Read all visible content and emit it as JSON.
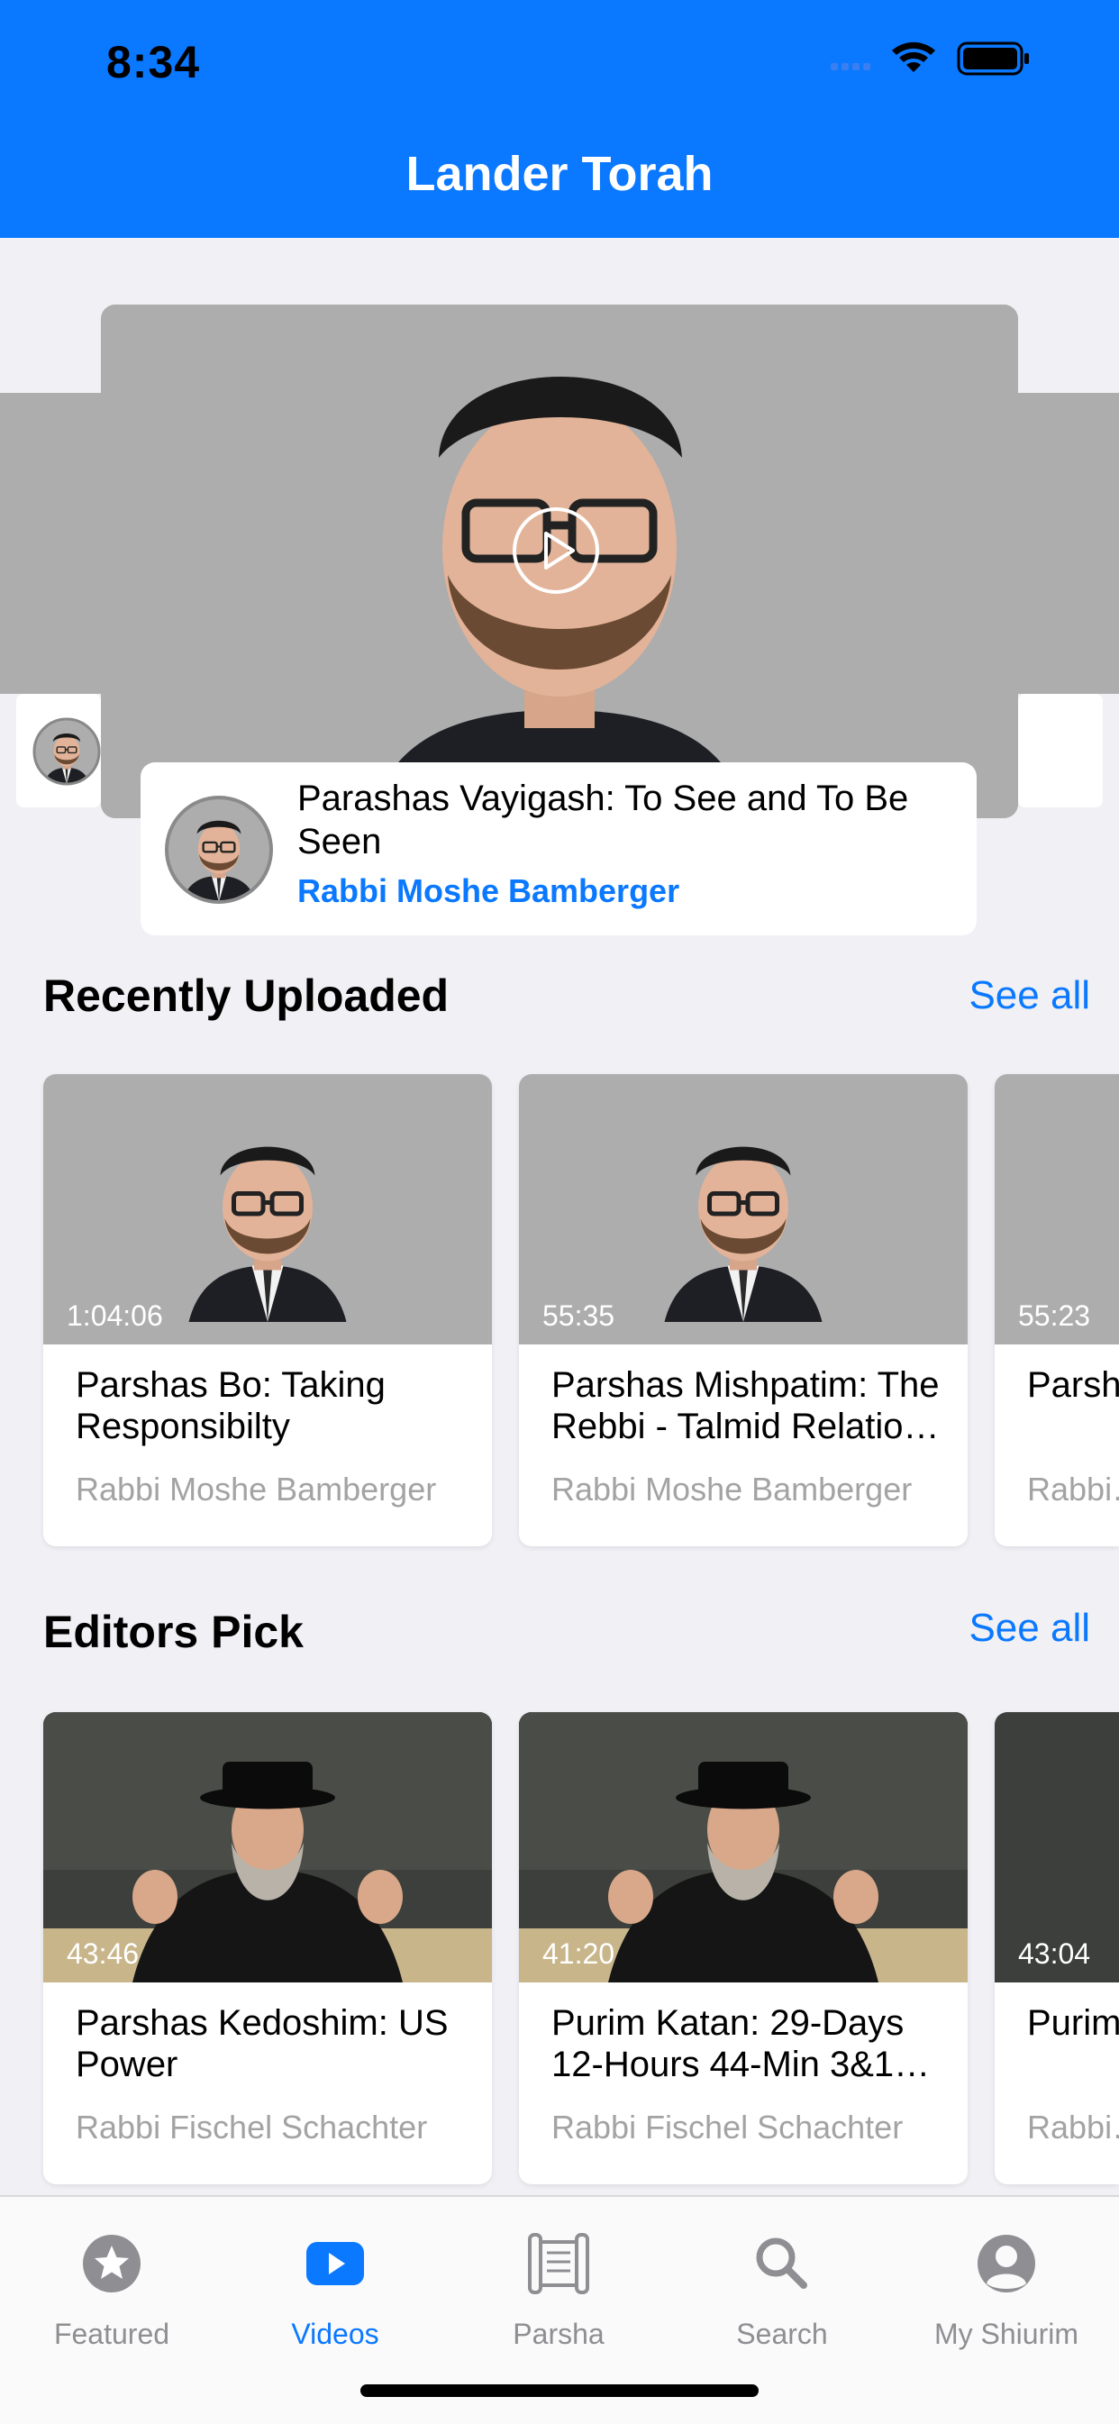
{
  "status_bar": {
    "time": "8:34"
  },
  "header": {
    "title": "Lander Torah"
  },
  "hero": {
    "title": "Parashas Vayigash: To See and To Be Seen",
    "speaker": "Rabbi Moshe Bamberger"
  },
  "recently_uploaded": {
    "title": "Recently Uploaded",
    "see_all": "See all",
    "items": [
      {
        "duration": "1:04:06",
        "title": "Parshas Bo: Taking Responsibilty",
        "speaker": "Rabbi Moshe Bamberger"
      },
      {
        "duration": "55:35",
        "title": "Parshas Mishpatim: The Rebbi - Talmid Relatio…",
        "speaker": "Rabbi Moshe Bamberger"
      },
      {
        "duration": "55:23",
        "title": "Parsh… it Dow…",
        "speaker": "Rabbi…"
      }
    ]
  },
  "editors_pick": {
    "title": "Editors Pick",
    "see_all": "See all",
    "items": [
      {
        "duration": "43:46",
        "title": "Parshas Kedoshim: US Power",
        "speaker": "Rabbi Fischel Schachter"
      },
      {
        "duration": "41:20",
        "title": "Purim Katan: 29-Days 12-Hours 44-Min 3&1…",
        "speaker": "Rabbi Fischel Schachter"
      },
      {
        "duration": "43:04",
        "title": "Purim…",
        "speaker": "Rabbi…"
      }
    ]
  },
  "tabbar": {
    "items": [
      {
        "label": "Featured",
        "icon": "star-icon",
        "active": false
      },
      {
        "label": "Videos",
        "icon": "video-play-icon",
        "active": true
      },
      {
        "label": "Parsha",
        "icon": "scroll-icon",
        "active": false
      },
      {
        "label": "Search",
        "icon": "search-icon",
        "active": false
      },
      {
        "label": "My Shiurim",
        "icon": "profile-icon",
        "active": false
      }
    ]
  },
  "colors": {
    "accent": "#0a78ff",
    "header": "#0a78ff",
    "thumb_gray": "#adadad",
    "muted": "#a3a3a3"
  }
}
